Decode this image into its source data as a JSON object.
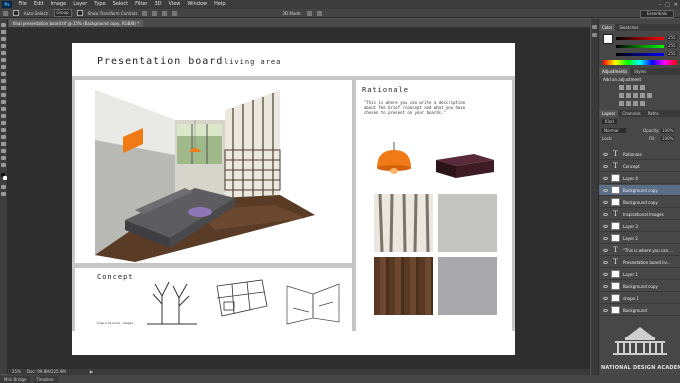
{
  "menu": {
    "app_icon": "Ps",
    "items": [
      "File",
      "Edit",
      "Image",
      "Layer",
      "Type",
      "Select",
      "Filter",
      "3D",
      "View",
      "Window",
      "Help"
    ]
  },
  "options": {
    "auto_select_label": "Auto-Select:",
    "auto_select_value": "Group",
    "transform_label": "Show Transform Controls",
    "mode_label": "3D Mode:",
    "workspace": "Essentials"
  },
  "document": {
    "tab_label": "final presentation board.tif @ 25% (Background copy, RGB/8) *",
    "zoom": "25%",
    "doc_size": "Doc: 99.8M/225.9M"
  },
  "board": {
    "title": "Presentation board",
    "subtitle": "living area",
    "rationale_heading": "Rationale",
    "rationale_text": [
      "\"This is where you can write a description",
      "about the brief /concept and what you have",
      "chosen to present on your boards.\""
    ],
    "concept_heading": "Concept",
    "inspirational_label": "Inspirational images"
  },
  "bottom_tabs": [
    "Mini Bridge",
    "Timeline"
  ],
  "panels": {
    "color_tabs": [
      "Color",
      "Swatches"
    ],
    "color_values": {
      "r": "255",
      "g": "255",
      "b": "255"
    },
    "adjust_tabs": [
      "Adjustments",
      "Styles"
    ],
    "adjust_title": "Add an adjustment",
    "layers_tabs": [
      "Layers",
      "Channels",
      "Paths"
    ],
    "kind_label": "Kind",
    "blend_mode": "Normal",
    "opacity_label": "Opacity:",
    "opacity_value": "100%",
    "lock_label": "Lock:",
    "fill_label": "Fill:",
    "fill_value": "100%"
  },
  "layers": [
    {
      "name": "Rationale",
      "type": "text"
    },
    {
      "name": "Concept",
      "type": "text"
    },
    {
      "name": "Layer 4",
      "type": "image"
    },
    {
      "name": "Background copy",
      "type": "image",
      "selected": true
    },
    {
      "name": "Background copy",
      "type": "image"
    },
    {
      "name": "Inspirational Images",
      "type": "text"
    },
    {
      "name": "Layer 3",
      "type": "image"
    },
    {
      "name": "Layer 2",
      "type": "image"
    },
    {
      "name": "\"This is where you can ...",
      "type": "text"
    },
    {
      "name": "Presentation board liv...",
      "type": "text"
    },
    {
      "name": "Layer 1",
      "type": "image"
    },
    {
      "name": "Background copy",
      "type": "image"
    },
    {
      "name": "shape 1",
      "type": "image"
    },
    {
      "name": "Background",
      "type": "image"
    }
  ],
  "watermark": {
    "name": "NATIONAL DESIGN ACADEMY"
  },
  "colors": {
    "workspace_bg": "#535353",
    "canvas_bg": "#2e2e2e",
    "selected_layer": "#5a6f86",
    "accent_orange": "#f07a16"
  }
}
